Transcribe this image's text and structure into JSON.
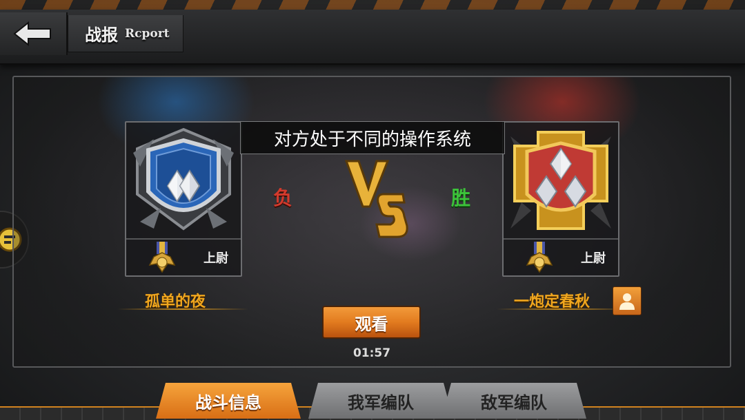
{
  "header": {
    "title_cn": "战报",
    "title_en": "Rcport"
  },
  "notice": "对方处于不同的操作系统",
  "left_player": {
    "name": "孤单的夜",
    "rank": "上尉",
    "result": "负"
  },
  "right_player": {
    "name": "一炮定春秋",
    "rank": "上尉",
    "result": "胜"
  },
  "watch_button": "观看",
  "timer": "01:57",
  "tabs": [
    {
      "label": "战斗信息",
      "active": true
    },
    {
      "label": "我军编队",
      "active": false
    },
    {
      "label": "敌军编队",
      "active": false
    }
  ],
  "colors": {
    "accent": "#e27b1f",
    "lose": "#d43a2c",
    "win": "#3cc23a",
    "name": "#f0a61e"
  }
}
